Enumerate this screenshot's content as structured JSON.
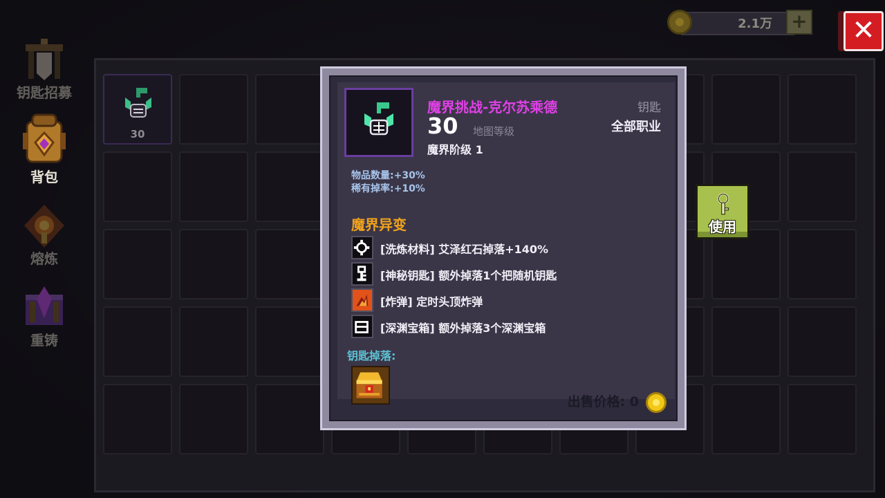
{
  "currency": {
    "amount": "2.1万",
    "add_icon": "plus-icon",
    "coin_icon": "gold-coin-icon"
  },
  "close_icon": "close-icon",
  "nav": [
    {
      "label": "钥匙招募",
      "icon": "key-recruit-gate-icon",
      "active": false
    },
    {
      "label": "背包",
      "icon": "backpack-icon",
      "active": true
    },
    {
      "label": "熔炼",
      "icon": "smelt-furnace-icon",
      "active": false
    },
    {
      "label": "重铸",
      "icon": "recast-chest-icon",
      "active": false
    }
  ],
  "inventory": {
    "slots": [
      {
        "filled": true,
        "icon": "abyss-key-icon",
        "count": "30"
      }
    ]
  },
  "tooltip": {
    "name": "魔界挑战-克尔苏乘德",
    "level": "30",
    "level_label": "地图等级",
    "tier": "魔界阶级 1",
    "type": "钥匙",
    "class": "全部职业",
    "stats": [
      "物品数量:+30%",
      "稀有掉率:+10%"
    ],
    "section_title": "魔界异变",
    "modifiers": [
      {
        "icon": "gear-icon",
        "text": "[洗炼材料] 艾泽红石掉落+140%"
      },
      {
        "icon": "key-icon",
        "text": "[神秘钥匙] 额外掉落1个把随机钥匙"
      },
      {
        "icon": "bomb-fire-icon",
        "text": "[炸弹] 定时头顶炸弹"
      },
      {
        "icon": "chest-icon",
        "text": "[深渊宝箱] 额外掉落3个深渊宝箱"
      }
    ],
    "drops_title": "钥匙掉落:",
    "drops": [
      {
        "icon": "golden-chest-icon"
      }
    ],
    "price_label": "出售价格: 0",
    "price_icon": "gold-coin-icon"
  },
  "use_button": {
    "label": "使用",
    "icon": "key-icon"
  },
  "colors": {
    "item_name": "#e040e6",
    "section_title": "#f0a21c",
    "stats": "#a8c4ea",
    "drops_title": "#5cc2d4",
    "close": "#d41d23",
    "use_button": "#a8c14e"
  }
}
